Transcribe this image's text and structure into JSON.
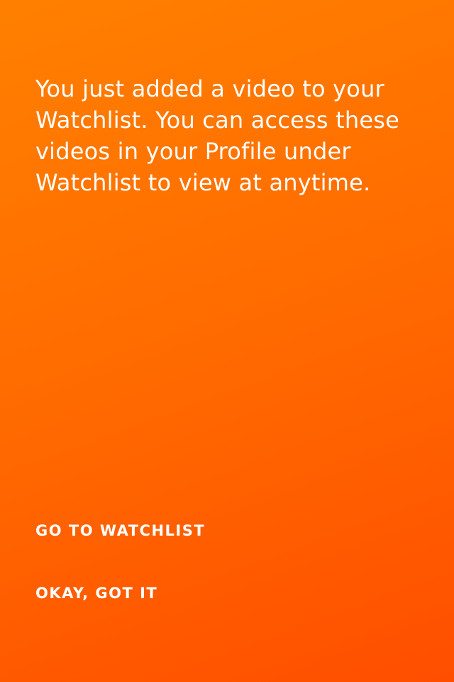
{
  "dialog": {
    "message": "You just added a video to your Watchlist. You can access these videos in your Profile under Watchlist to view at anytime.",
    "actions": {
      "go_to_watchlist": "GO TO WATCHLIST",
      "okay_got_it": "OKAY, GOT IT"
    }
  },
  "colors": {
    "background_start": "#ff8000",
    "background_end": "#ff4e00",
    "text": "#ffffff"
  }
}
